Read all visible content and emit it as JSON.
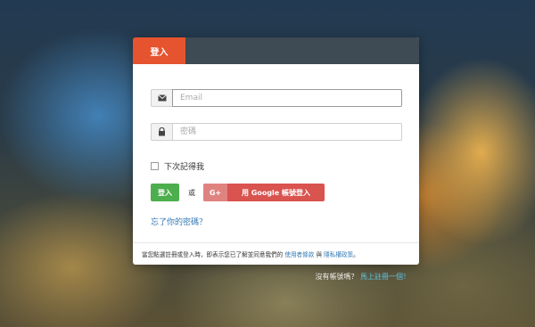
{
  "login_card": {
    "tab_label": "登入",
    "email": {
      "placeholder": "Email",
      "value": "",
      "icon": "envelope-icon"
    },
    "password": {
      "placeholder": "密碼",
      "value": "",
      "icon": "lock-icon"
    },
    "remember_label": "下次記得我",
    "remember_checked": false,
    "login_button_label": "登入",
    "or_text": "或",
    "google_button": {
      "icon_text": "G+",
      "label": "用 Google 帳號登入"
    },
    "forgot_link": "忘了你的密碼？",
    "terms": {
      "prefix": "當您點選註冊或登入時，即表示您已了解並同意我們的",
      "terms_link": "使用者條款",
      "and": "與",
      "privacy_link": "隱私權政策",
      "suffix": "。"
    }
  },
  "signup_prompt": {
    "text": "沒有帳號嗎？",
    "link": "馬上註冊一個！"
  },
  "colors": {
    "tab_active": "#e5542e",
    "header_bar": "#3e4a54",
    "login_button": "#4cae4c",
    "google_button": "#d9534f",
    "link": "#337ab7"
  }
}
